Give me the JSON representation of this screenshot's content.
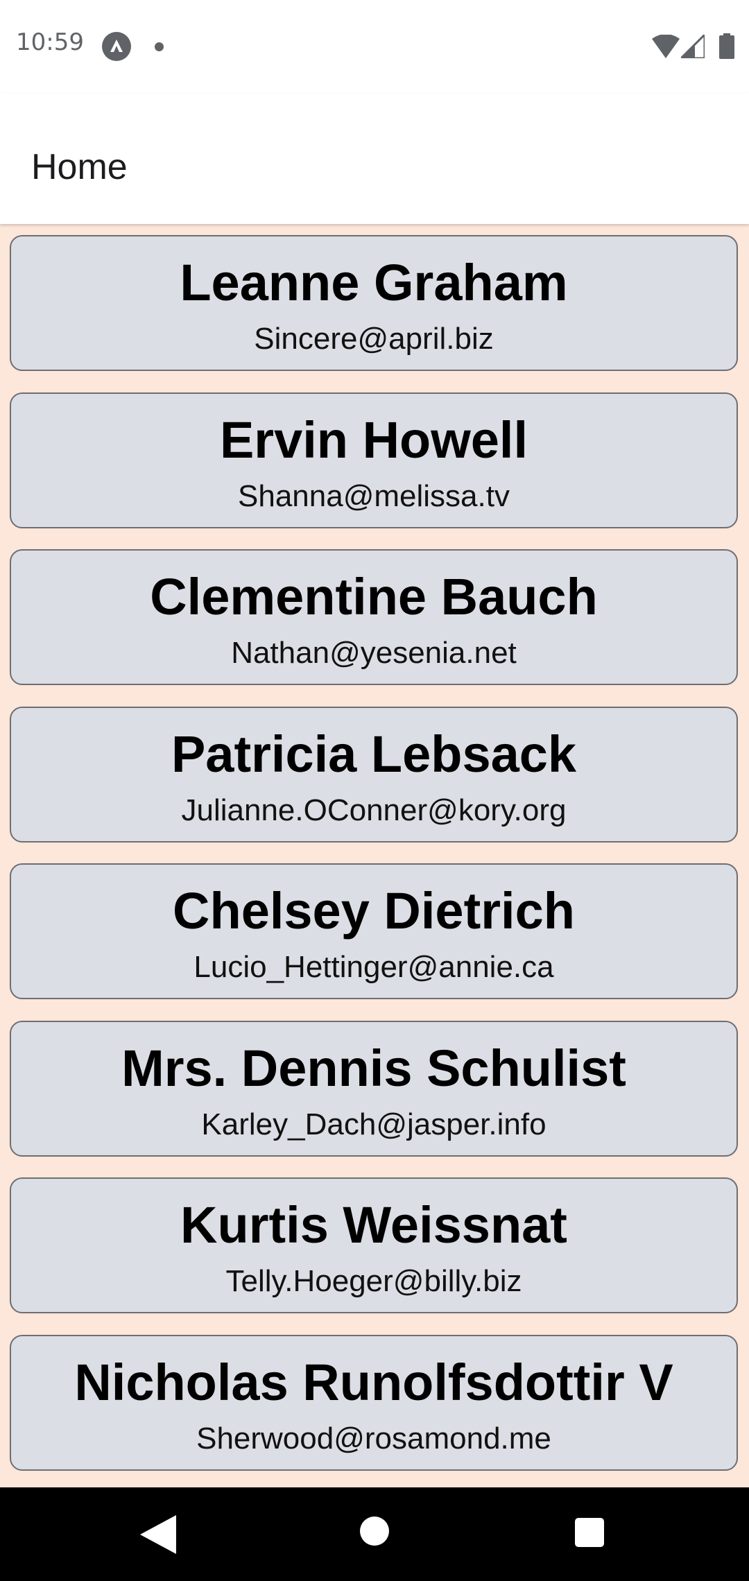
{
  "status_bar": {
    "time": "10:59",
    "icons": [
      "app-notification-icon",
      "notification-dot-icon",
      "wifi-icon",
      "signal-icon",
      "battery-icon"
    ]
  },
  "app_bar": {
    "title": "Home"
  },
  "users": [
    {
      "name": "Leanne Graham",
      "email": "Sincere@april.biz"
    },
    {
      "name": "Ervin Howell",
      "email": "Shanna@melissa.tv"
    },
    {
      "name": "Clementine Bauch",
      "email": "Nathan@yesenia.net"
    },
    {
      "name": "Patricia Lebsack",
      "email": "Julianne.OConner@kory.org"
    },
    {
      "name": "Chelsey Dietrich",
      "email": "Lucio_Hettinger@annie.ca"
    },
    {
      "name": "Mrs. Dennis Schulist",
      "email": "Karley_Dach@jasper.info"
    },
    {
      "name": "Kurtis Weissnat",
      "email": "Telly.Hoeger@billy.biz"
    },
    {
      "name": "Nicholas Runolfsdottir V",
      "email": "Sherwood@rosamond.me"
    }
  ],
  "nav_bar": {
    "icons": [
      "back-icon",
      "home-icon",
      "recents-icon"
    ]
  },
  "colors": {
    "page_background": "#fde6da",
    "card_background": "#dcdee5",
    "card_border": "#6e6e72",
    "app_bar_background": "#ffffff",
    "nav_bar_background": "#000000"
  }
}
